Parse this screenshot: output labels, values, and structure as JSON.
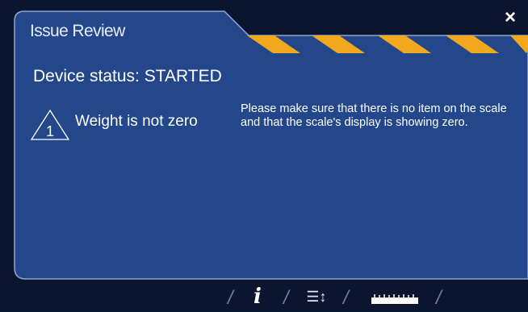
{
  "dialog": {
    "title": "Issue Review",
    "close_label": "×",
    "device_status": "Device status: STARTED"
  },
  "issue": {
    "number": "1",
    "title": "Weight is not zero",
    "description": "Please make sure that there is no item on the scale and that the scale's display is showing zero."
  },
  "toolbar": {
    "separator": "/",
    "info_label": "i",
    "sort_label": "☰↕",
    "icons": [
      "info-icon",
      "sort-list-icon",
      "ruler-icon"
    ]
  },
  "colors": {
    "panel": "#23478a",
    "panel_border": "#8fa7cf",
    "stripe": "#f2a81c",
    "background": "#0b1530"
  }
}
